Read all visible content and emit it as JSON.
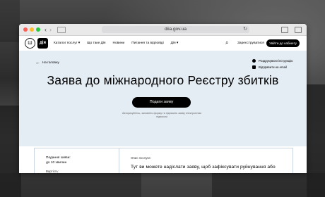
{
  "browser": {
    "url": "diia.gov.ua"
  },
  "header": {
    "logo": "дія",
    "menu": [
      "Каталог послуг ▾",
      "Що таке Дія",
      "Новини",
      "Питання та відповіді",
      "Дія ▾"
    ],
    "register_label": "Зареєструватися",
    "cabinet_label": "Увійти до кабінету"
  },
  "page": {
    "back_label": "На головну",
    "side_links": [
      "Роздрукувати інструкцію",
      "Відправити на email"
    ],
    "title": "Заява до міжнародного Реєстру збитків",
    "submit_label": "Подати заяву",
    "note": "Авторизуйтесь, заповніть форму та підпишіть заяву електронним підписом"
  },
  "info": {
    "time_label": "Подання заяви:",
    "time_value": "до 10 хвилин",
    "cost_label": "Вартість:",
    "desc_label": "Опис послуги:",
    "desc_text": "Тут ви можете надіслати заяву, щоб зафіксувати руйнування або"
  },
  "colors": {
    "hero_bg": "#e4ecf4",
    "accent": "#000000",
    "card_border": "#c9d6e2"
  },
  "icons": {
    "search": "search-icon",
    "back": "arrow-left-icon",
    "print": "print-icon",
    "email": "email-icon",
    "reload": "reload-icon",
    "trident": "trident-icon"
  }
}
